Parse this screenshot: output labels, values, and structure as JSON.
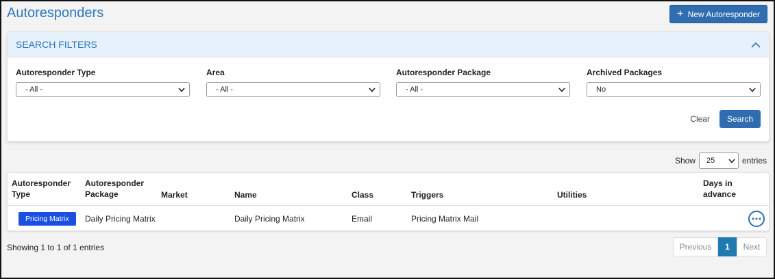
{
  "header": {
    "title": "Autoresponders",
    "new_button": "New Autoresponder"
  },
  "filters": {
    "title": "SEARCH FILTERS",
    "fields": [
      {
        "label": "Autoresponder Type",
        "value": "- All -"
      },
      {
        "label": "Area",
        "value": "- All -"
      },
      {
        "label": "Autoresponder Package",
        "value": "- All -"
      },
      {
        "label": "Archived Packages",
        "value": "No"
      }
    ],
    "clear_label": "Clear",
    "search_label": "Search"
  },
  "length": {
    "show": "Show",
    "value": "25",
    "entries": "entries"
  },
  "table": {
    "columns": [
      "Autoresponder Type",
      "Autoresponder Package",
      "Market",
      "Name",
      "Class",
      "Triggers",
      "Utilities",
      "Days in advance"
    ],
    "rows": [
      {
        "type": "Pricing Matrix",
        "package": "Daily Pricing Matrix",
        "market": "",
        "name": "Daily Pricing Matrix",
        "class": "Email",
        "triggers": "Pricing Matrix Mail",
        "utilities": "",
        "days": ""
      }
    ]
  },
  "footer": {
    "showing": "Showing 1 to 1 of 1 entries",
    "previous": "Previous",
    "current_page": "1",
    "next": "Next"
  },
  "colors": {
    "accent": "#2f6cb0",
    "title": "#2b77c0",
    "badge": "#1a4fe0",
    "page_current": "#1f7ab0"
  },
  "icons": {
    "new": "plus-icon",
    "collapse": "chevron-up-icon",
    "select": "chevron-down-icon",
    "row_menu": "more-horizontal-icon"
  }
}
